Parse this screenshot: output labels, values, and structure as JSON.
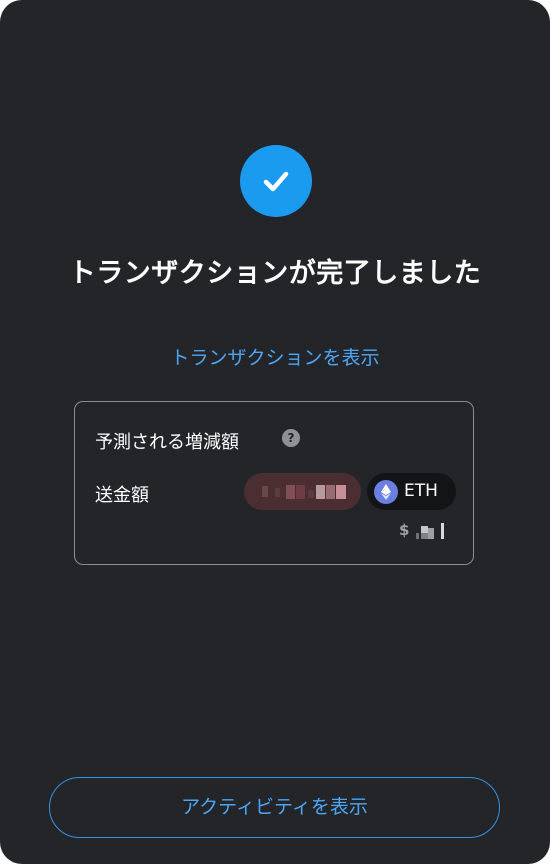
{
  "status": {
    "icon": "check-icon",
    "title": "トランザクションが完了しました",
    "view_transaction_link": "トランザクションを表示"
  },
  "balance_changes": {
    "heading": "予測される増減額",
    "help_icon": "question-icon",
    "help_glyph": "?",
    "row_label": "送金額",
    "amount_redacted": true,
    "token": {
      "symbol": "ETH",
      "icon": "ethereum-icon"
    },
    "fiat_symbol": "$",
    "fiat_redacted": true
  },
  "footer": {
    "activity_button_label": "アクティビティを表示"
  },
  "colors": {
    "background": "#232529",
    "accent_blue": "#1a9bf0",
    "link_blue": "#4da6f5",
    "amount_pill": "#4a2e32",
    "token_pill": "#131416",
    "eth_icon": "#6b7fe3"
  }
}
